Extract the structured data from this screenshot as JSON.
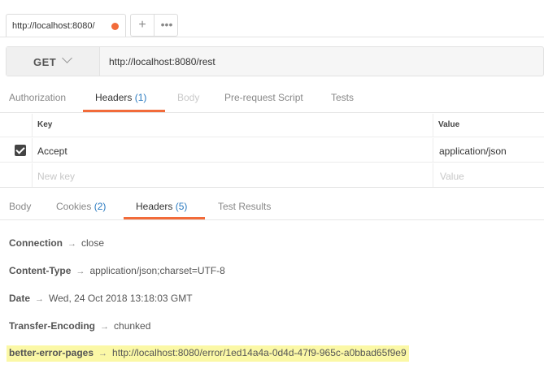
{
  "tab": {
    "title": "http://localhost:8080/",
    "plus": "+",
    "more": "•••"
  },
  "request": {
    "method": "GET",
    "url": "http://localhost:8080/rest"
  },
  "request_tabs": {
    "authorization": "Authorization",
    "headers_label": "Headers",
    "headers_count": "(1)",
    "body": "Body",
    "prerequest": "Pre-request Script",
    "tests": "Tests"
  },
  "headers_table": {
    "key_header": "Key",
    "value_header": "Value",
    "rows": [
      {
        "key": "Accept",
        "value": "application/json",
        "checked": true
      }
    ],
    "new_key_placeholder": "New key",
    "new_value_placeholder": "Value"
  },
  "response_tabs": {
    "body": "Body",
    "cookies_label": "Cookies",
    "cookies_count": "(2)",
    "headers_label": "Headers",
    "headers_count": "(5)",
    "test_results": "Test Results"
  },
  "response_headers": [
    {
      "name": "Connection",
      "arrow": "→",
      "value": "close"
    },
    {
      "name": "Content-Type",
      "arrow": "→",
      "value": "application/json;charset=UTF-8"
    },
    {
      "name": "Date",
      "arrow": "→",
      "value": "Wed, 24 Oct 2018 13:18:03 GMT"
    },
    {
      "name": "Transfer-Encoding",
      "arrow": "→",
      "value": "chunked"
    },
    {
      "name": "better-error-pages",
      "arrow": "→",
      "value": "http://localhost:8080/error/1ed14a4a-0d4d-47f9-965c-a0bbad65f9e9"
    }
  ],
  "colors": {
    "accent": "#f26b3a",
    "count_blue": "#2a7ac0",
    "highlight": "#fbf8a6"
  }
}
